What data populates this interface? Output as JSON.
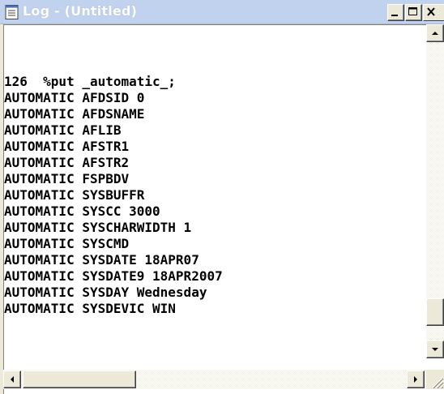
{
  "window": {
    "title": "Log - (Untitled)",
    "title_icon": "document-icon"
  },
  "log": {
    "lines": [
      "126  %put _automatic_;",
      "AUTOMATIC AFDSID 0",
      "AUTOMATIC AFDSNAME",
      "AUTOMATIC AFLIB",
      "AUTOMATIC AFSTR1",
      "AUTOMATIC AFSTR2",
      "AUTOMATIC FSPBDV",
      "AUTOMATIC SYSBUFFR",
      "AUTOMATIC SYSCC 3000",
      "AUTOMATIC SYSCHARWIDTH 1",
      "AUTOMATIC SYSCMD",
      "AUTOMATIC SYSDATE 18APR07",
      "AUTOMATIC SYSDATE9 18APR2007",
      "AUTOMATIC SYSDAY Wednesday",
      "AUTOMATIC SYSDEVIC WIN"
    ]
  },
  "colors": {
    "titlebar_inactive": "#c1d2ee",
    "face": "#ece9d8",
    "text": "#000000"
  }
}
